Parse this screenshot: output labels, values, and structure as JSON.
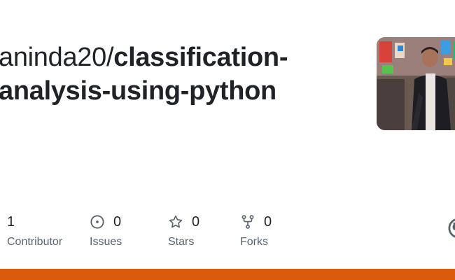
{
  "repo": {
    "owner_prefix": "aninda20/",
    "name_line1": "classification-",
    "name_line2": "analysis-using-python"
  },
  "stats": [
    {
      "count": "1",
      "label": "Contributor",
      "icon": "people-icon"
    },
    {
      "count": "0",
      "label": "Issues",
      "icon": "issue-opened-icon"
    },
    {
      "count": "0",
      "label": "Stars",
      "icon": "star-icon"
    },
    {
      "count": "0",
      "label": "Forks",
      "icon": "repo-forked-icon"
    }
  ],
  "colors": {
    "language_bar": "#DA5B0B",
    "text_primary": "#1f2328",
    "text_muted": "#59636e"
  }
}
